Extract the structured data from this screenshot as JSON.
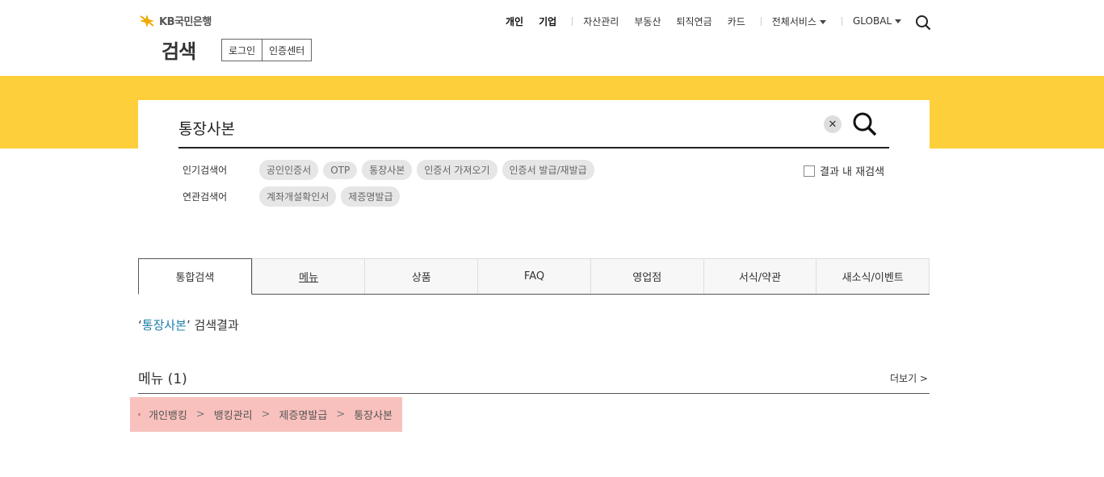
{
  "brand": {
    "logo_text": "KB국민은행",
    "accent": "#fdcf3a",
    "logo_color": "#f2a900"
  },
  "page_title": "검색",
  "util_buttons": [
    "로그인",
    "인증센터"
  ],
  "gnb": {
    "items": [
      "개인",
      "기업",
      "자산관리",
      "부동산",
      "퇴직연금",
      "카드",
      "전체서비스",
      "GLOBAL"
    ]
  },
  "search": {
    "query": "통장사본",
    "clear_label": "✕"
  },
  "keywords": {
    "popular_label": "인기검색어",
    "popular": [
      "공인인증서",
      "OTP",
      "통장사본",
      "인증서 가져오기",
      "인증서 발급/재발급"
    ],
    "related_label": "연관검색어",
    "related": [
      "계좌개설확인서",
      "제증명발급"
    ]
  },
  "recheck_label": "결과 내 재검색",
  "tabs": [
    "통합검색",
    "메뉴",
    "상품",
    "FAQ",
    "영업점",
    "서식/약관",
    "새소식/이벤트"
  ],
  "result": {
    "open": "‘",
    "keyword": "통장사본",
    "suffix": "’ 검색결과"
  },
  "section": {
    "title": "메뉴 (1)",
    "more": "더보기 >"
  },
  "path": [
    "개인뱅킹",
    "뱅킹관리",
    "제증명발급",
    "통장사본"
  ],
  "path_sep": ">"
}
